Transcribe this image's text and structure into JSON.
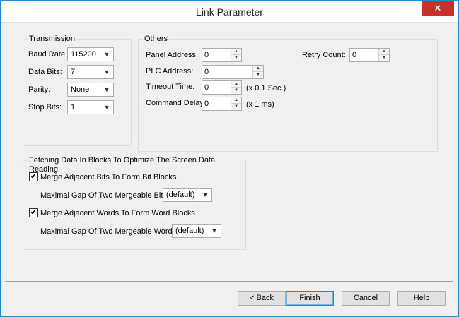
{
  "window": {
    "title": "Link Parameter",
    "close_glyph": "✕"
  },
  "transmission": {
    "legend": "Transmission",
    "baud_rate_label": "Baud Rate:",
    "baud_rate_value": "115200",
    "data_bits_label": "Data Bits:",
    "data_bits_value": "7",
    "parity_label": "Parity:",
    "parity_value": "None",
    "stop_bits_label": "Stop Bits:",
    "stop_bits_value": "1"
  },
  "others": {
    "legend": "Others",
    "panel_address_label": "Panel Address:",
    "panel_address_value": "0",
    "plc_address_label": "PLC Address:",
    "plc_address_value": "0",
    "timeout_label": "Timeout Time:",
    "timeout_value": "0",
    "timeout_unit": "(x 0.1 Sec.)",
    "command_delay_label": "Command Delay:",
    "command_delay_value": "0",
    "command_delay_unit": "(x 1 ms)",
    "retry_count_label": "Retry Count:",
    "retry_count_value": "0"
  },
  "fetching": {
    "legend": "Fetching Data In Blocks To Optimize The Screen Data Reading",
    "merge_bits_label": "Merge Adjacent Bits To Form Bit Blocks",
    "merge_bits_checked": true,
    "gap_bits_label": "Maximal Gap Of Two Mergeable Bits:",
    "gap_bits_value": "(default)",
    "merge_words_label": "Merge Adjacent Words To Form Word Blocks",
    "merge_words_checked": true,
    "gap_words_label": "Maximal Gap Of Two Mergeable Words:",
    "gap_words_value": "(default)",
    "check_glyph": "✔"
  },
  "buttons": {
    "back": "< Back",
    "finish": "Finish",
    "cancel": "Cancel",
    "help": "Help"
  },
  "icons": {
    "dropdown": "▼",
    "spin_up": "▲",
    "spin_down": "▼"
  },
  "colors": {
    "close_button": "#c7312c",
    "window_border": "#1f8ad2",
    "client_background": "#f0f0f0"
  }
}
